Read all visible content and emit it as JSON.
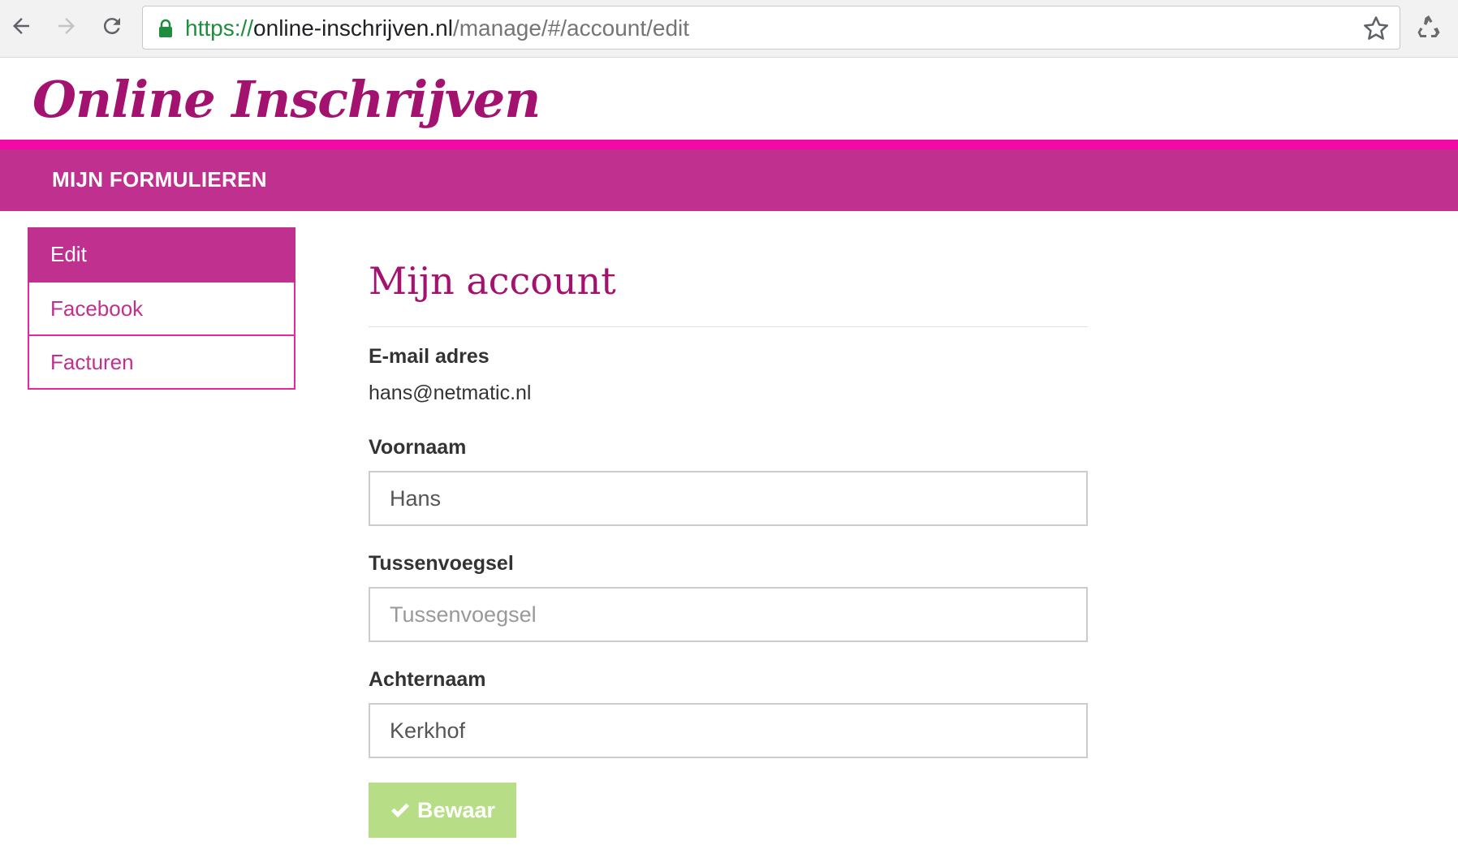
{
  "browser": {
    "url_scheme": "https://",
    "url_host": "online-inschrijven.nl",
    "url_path": "/manage/#/account/edit"
  },
  "header": {
    "logo_text": "Online Inschrijven"
  },
  "navbar": {
    "forms_link": "MIJN FORMULIEREN"
  },
  "sidebar": {
    "items": [
      {
        "label": "Edit",
        "active": true
      },
      {
        "label": "Facebook",
        "active": false
      },
      {
        "label": "Facturen",
        "active": false
      }
    ]
  },
  "main": {
    "title": "Mijn account",
    "email_label": "E-mail adres",
    "email_value": "hans@netmatic.nl",
    "first_name_label": "Voornaam",
    "first_name_value": "Hans",
    "infix_label": "Tussenvoegsel",
    "infix_value": "",
    "infix_placeholder": "Tussenvoegsel",
    "last_name_label": "Achternaam",
    "last_name_value": "Kerkhof",
    "save_label": "Bewaar"
  },
  "colors": {
    "brand": "#c0308e",
    "brand_dark": "#a3126f",
    "accent_line": "#f20aa5",
    "save_button": "#b8dd87"
  }
}
